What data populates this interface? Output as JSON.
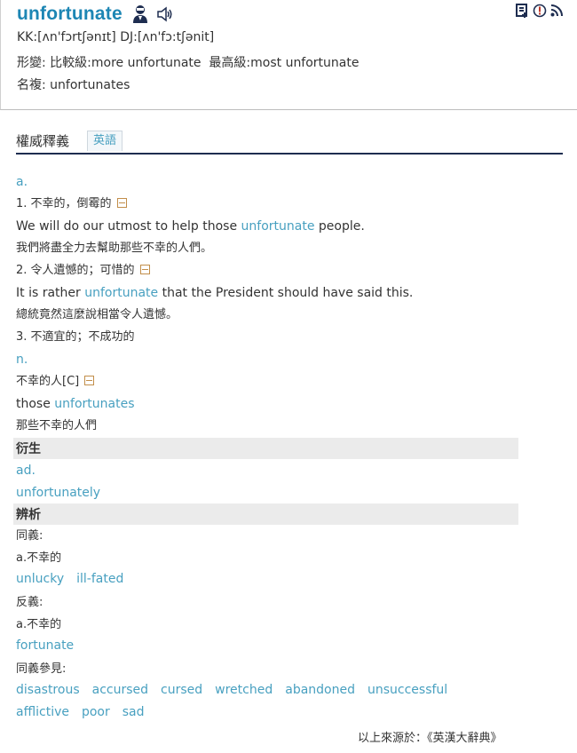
{
  "entry": {
    "word": "unfortunate",
    "pronunciation": "KK:[ʌn'fɔrtʃənɪt] DJ:[ʌn'fɔ:tʃənit]",
    "forms": "形變: 比較級:more unfortunate  最高級:most unfortunate",
    "plural": "名複: unfortunates",
    "icons": [
      "person-pronounce-icon",
      "speaker-icon",
      "add-to-wordbook-icon",
      "report-icon",
      "rss-icon"
    ]
  },
  "section": {
    "title": "權威釋義",
    "tab": "英語"
  },
  "senses": {
    "pos_adj": "a.",
    "def1": "1. 不幸的，倒霉的",
    "ex1_before": "We will do our utmost to help those ",
    "ex1_hl": "unfortunate",
    "ex1_after": " people.",
    "ex1_zh": "我們將盡全力去幫助那些不幸的人們。",
    "def2": "2. 令人遺憾的；可惜的",
    "ex2_before": "It is rather ",
    "ex2_hl": "unfortunate",
    "ex2_after": " that the President should have said this.",
    "ex2_zh": "總統竟然這麼說相當令人遺憾。",
    "def3": "3. 不適宜的；不成功的",
    "pos_noun": "n.",
    "def_n": "不幸的人[C]",
    "exn_before": "those ",
    "exn_hl": "unfortunates",
    "exn_zh": "那些不幸的人們"
  },
  "derived": {
    "heading": "衍生",
    "pos": "ad.",
    "word": "unfortunately"
  },
  "analysis": {
    "heading": "辨析",
    "syn_label": "同義:",
    "syn_pos": "a.不幸的",
    "synonyms": [
      "unlucky",
      "ill-fated"
    ],
    "ant_label": "反義:",
    "ant_pos": "a.不幸的",
    "antonyms": [
      "fortunate"
    ],
    "see_label": "同義參見:",
    "see_row1": [
      "disastrous",
      "accursed",
      "cursed",
      "wretched",
      "abandoned",
      "unsuccessful"
    ],
    "see_row2": [
      "afflictive",
      "poor",
      "sad"
    ]
  },
  "footer": {
    "source": "以上來源於：《英漢大辭典》"
  },
  "colors": {
    "accent": "#48a0c0",
    "word": "#1d86b4",
    "band": "#ebebeb",
    "rule": "#1e2d50"
  }
}
